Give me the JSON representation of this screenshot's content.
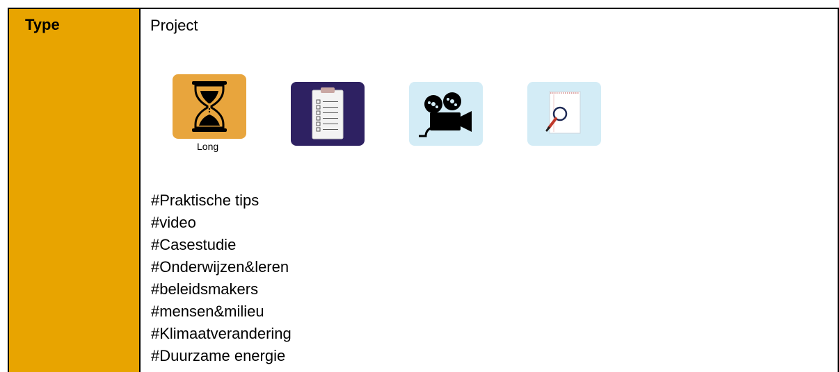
{
  "row": {
    "label": "Type",
    "value": "Project"
  },
  "icons": [
    {
      "name": "hourglass-icon",
      "caption": "Long",
      "background": "#e8a53d"
    },
    {
      "name": "clipboard-checklist-icon",
      "caption": "",
      "background": "#2e2162"
    },
    {
      "name": "video-camera-icon",
      "caption": "",
      "background": "#d3ecf6"
    },
    {
      "name": "magnifier-notepad-icon",
      "caption": "",
      "background": "#d3ecf6"
    }
  ],
  "tags": [
    "#Praktische tips",
    "#video",
    "#Casestudie",
    "#Onderwijzen&leren",
    "#beleidsmakers",
    "#mensen&milieu",
    "#Klimaatverandering",
    "#Duurzame energie"
  ],
  "colors": {
    "label_cell": "#e8a400",
    "border": "#000000"
  }
}
